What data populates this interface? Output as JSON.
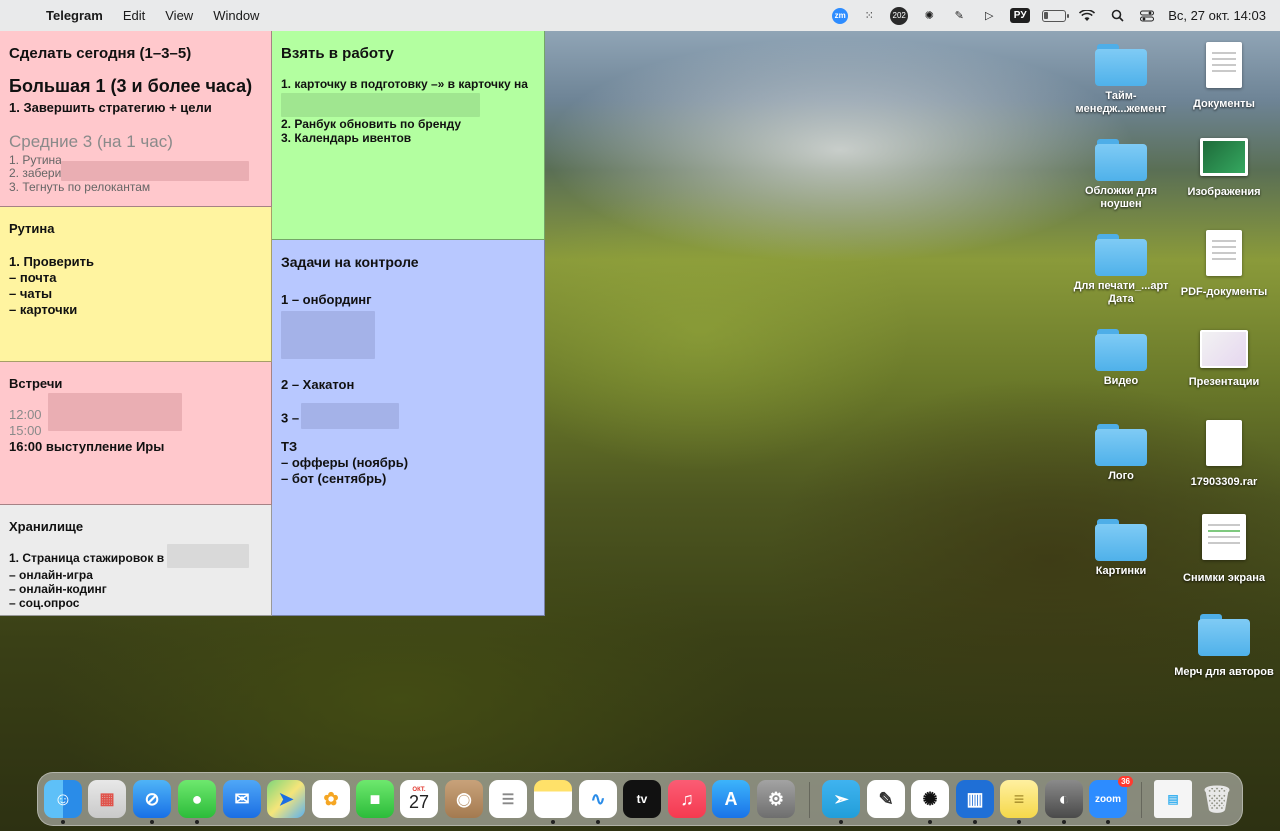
{
  "menubar": {
    "app_name": "Telegram",
    "menus": [
      "Edit",
      "View",
      "Window"
    ],
    "zoom_icon_text": "zm",
    "notif_badge": "202",
    "input_source": "РУ",
    "clock": "Вс, 27 окт.  14:03"
  },
  "notes": {
    "today": {
      "title": "Сделать сегодня (1–3–5)",
      "big_title": "Большая 1 (3 и более часа)",
      "big_item": "1. Завершить стратегию + цели",
      "mid_title": "Средние 3 (на 1 час)",
      "mid_items": [
        "1. Рутина",
        "2. забери",
        "3. Тегнуть по релокантам"
      ]
    },
    "work": {
      "title": "Взять в работу",
      "items": [
        "1. карточку в подготовку –» в карточку на",
        "2. Ранбук обновить по бренду",
        "3. Календарь ивентов"
      ]
    },
    "routine": {
      "title": "Рутина",
      "items": [
        "1. Проверить",
        "– почта",
        "– чаты",
        "– карточки"
      ]
    },
    "control": {
      "title": "Задачи на контроле",
      "item1": "1 – онбординг",
      "item2": "2 – Хакатон",
      "item3": "3 –",
      "tz": "ТЗ",
      "tz_items": [
        "– офферы (ноябрь)",
        "– бот (сентябрь)"
      ]
    },
    "meetings": {
      "title": "Встречи",
      "items": [
        "12:00",
        "15:00",
        "16:00 выступление Иры"
      ]
    },
    "storage": {
      "title": "Хранилище",
      "items": [
        "1. Страница стажировок в",
        "– онлайн-игра",
        "– онлайн-кодинг",
        "– соц.опрос"
      ]
    }
  },
  "desktop_icons": [
    {
      "label": "Тайм-менедж...жемент",
      "type": "folder"
    },
    {
      "label": "Документы",
      "type": "doc"
    },
    {
      "label": "Обложки для ноушен",
      "type": "folder"
    },
    {
      "label": "Изображения",
      "type": "image"
    },
    {
      "label": "Для печати_...арт Дата",
      "type": "folder"
    },
    {
      "label": "PDF-документы",
      "type": "doc"
    },
    {
      "label": "Видео",
      "type": "folder"
    },
    {
      "label": "Презентации",
      "type": "image"
    },
    {
      "label": "Лого",
      "type": "folder"
    },
    {
      "label": "17903309.rar",
      "type": "doc"
    },
    {
      "label": "Картинки",
      "type": "folder"
    },
    {
      "label": "Снимки экрана",
      "type": "doc"
    },
    {
      "label": "Мерч для авторов",
      "type": "folder"
    }
  ],
  "dock": {
    "calendar_month": "ОКТ.",
    "calendar_day": "27",
    "tv_label": "tv",
    "zoom_label": "zoom",
    "zoom_badge": "36",
    "apps": [
      "finder",
      "launchpad",
      "safari",
      "messages",
      "mail",
      "maps",
      "photos",
      "facetime",
      "calendar",
      "contacts",
      "reminders",
      "notes",
      "freeform",
      "tv",
      "music",
      "app-store",
      "system-settings",
      "telegram",
      "notchmeister",
      "chatgpt",
      "trello",
      "stickies",
      "preview",
      "zoom",
      "downloads",
      "trash"
    ]
  }
}
